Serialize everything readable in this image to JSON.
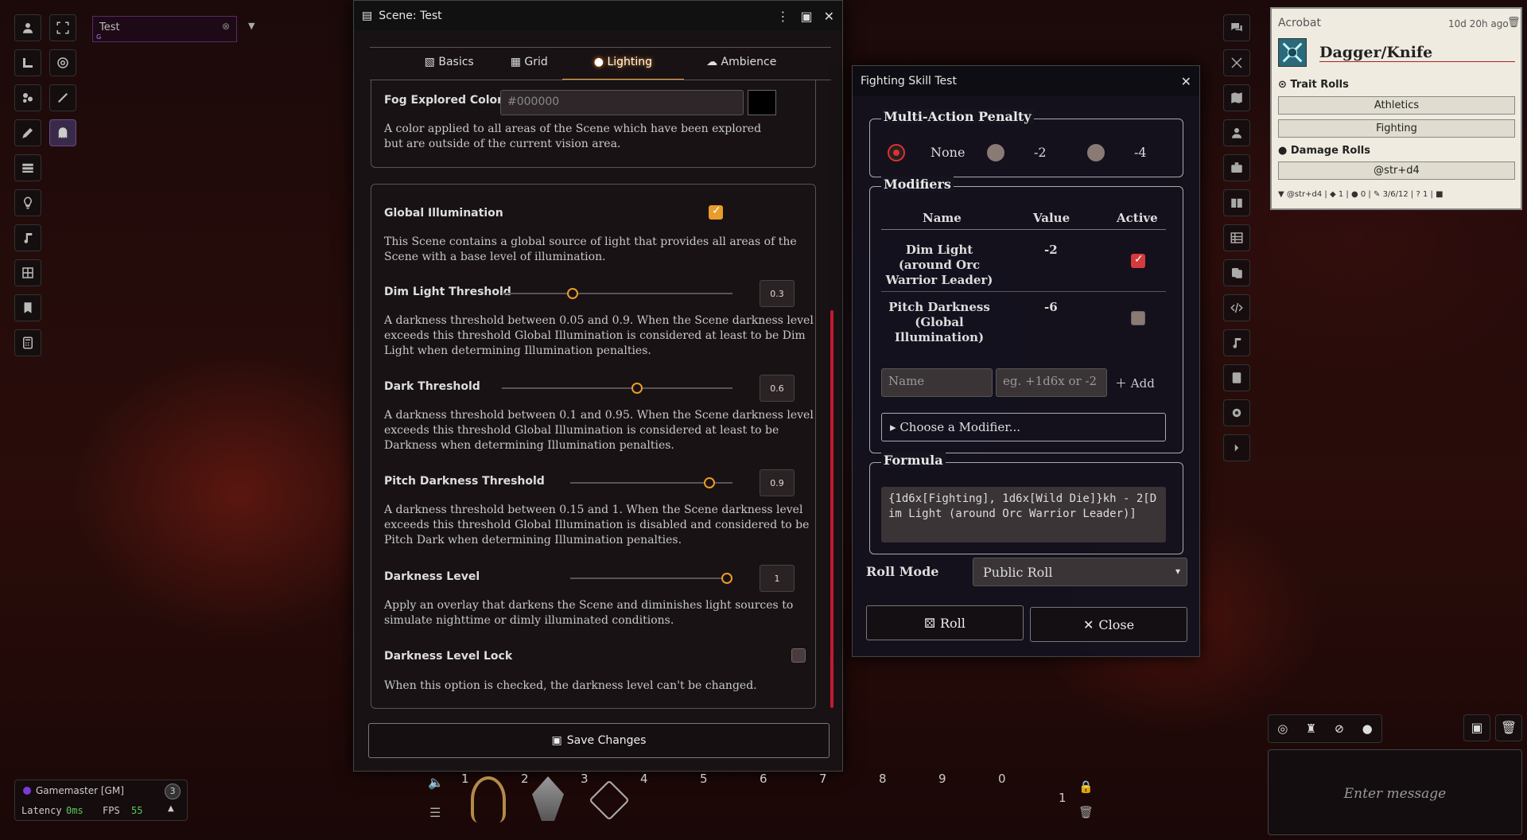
{
  "scene_nav": {
    "tab_label": "Test",
    "tab_sub": "G"
  },
  "scene_window": {
    "title": "Scene: Test",
    "tabs": [
      {
        "label": "Basics"
      },
      {
        "label": "Grid"
      },
      {
        "label": "Lighting"
      },
      {
        "label": "Ambience"
      }
    ],
    "fog": {
      "label": "Fog Explored Color",
      "value": "#000000",
      "hint": "A color applied to all areas of the Scene which have been explored but are outside of the current vision area."
    },
    "global": {
      "label": "Global Illumination",
      "hint": "This Scene contains a global source of light that provides all areas of the Scene with a base level of illumination."
    },
    "dim": {
      "label": "Dim Light Threshold",
      "value": "0.3",
      "level": 0.3,
      "hint": "A darkness threshold between 0.05 and 0.9. When the Scene darkness level exceeds this threshold Global Illumination is considered at least to be Dim Light when determining Illumination penalties."
    },
    "dark": {
      "label": "Dark Threshold",
      "value": "0.6",
      "level": 0.6,
      "hint": "A darkness threshold between 0.1 and 0.95. When the Scene darkness level exceeds this threshold Global Illumination is considered at least to be Darkness when determining Illumination penalties."
    },
    "pitch": {
      "label": "Pitch Darkness Threshold",
      "value": "0.9",
      "level": 0.9,
      "hint": "A darkness threshold between 0.15 and 1. When the Scene darkness level exceeds this threshold Global Illumination is disabled and considered to be Pitch Dark when determining Illumination penalties."
    },
    "level": {
      "label": "Darkness Level",
      "value": "1",
      "level": 1,
      "hint": "Apply an overlay that darkens the Scene and diminishes light sources to simulate nighttime or dimly illuminated conditions."
    },
    "lock": {
      "label": "Darkness Level Lock",
      "hint": "When this option is checked, the darkness level can't be changed."
    },
    "save_label": "Save Changes"
  },
  "skill_window": {
    "title": "Fighting Skill Test",
    "map": {
      "legend": "Multi-Action Penalty",
      "options": [
        {
          "label": "None"
        },
        {
          "label": "-2"
        },
        {
          "label": "-4"
        }
      ]
    },
    "mods": {
      "legend": "Modifiers",
      "headers": [
        "Name",
        "Value",
        "Active"
      ],
      "rows": [
        {
          "name": "Dim Light (around Orc Warrior Leader)",
          "value": "-2"
        },
        {
          "name": "Pitch Darkness (Global Illumination)",
          "value": "-6"
        }
      ],
      "name_placeholder": "Name",
      "value_placeholder": "eg. +1d6x or -2",
      "add_label": "Add",
      "choose_label": "Choose a Modifier..."
    },
    "formula": {
      "legend": "Formula",
      "text": "{1d6x[Fighting], 1d6x[Wild Die]}kh - 2[Dim Light (around Orc Warrior Leader)]"
    },
    "roll_mode": {
      "label": "Roll Mode",
      "value": "Public Roll"
    },
    "roll_label": "Roll",
    "close_label": "Close"
  },
  "card": {
    "actor": "Acrobat",
    "time": "10d 20h ago",
    "item": "Dagger/Knife",
    "trait_header": "Trait Rolls",
    "trait_buttons": [
      "Athletics",
      "Fighting"
    ],
    "damage_header": "Damage Rolls",
    "damage_buttons": [
      "@str+d4"
    ],
    "footer": {
      "damage": "@str+d4",
      "a": "1",
      "b": "0",
      "range": "3/6/12",
      "c": "1"
    }
  },
  "player": {
    "name": "Gamemaster [GM]",
    "badge": "3",
    "latency_label": "Latency",
    "latency": "0ms",
    "fps_label": "FPS",
    "fps": "55"
  },
  "hotbar": {
    "slots": [
      "1",
      "2",
      "3",
      "4",
      "5",
      "6",
      "7",
      "8",
      "9",
      "0"
    ],
    "page": "1"
  },
  "chat": {
    "placeholder": "Enter message"
  }
}
